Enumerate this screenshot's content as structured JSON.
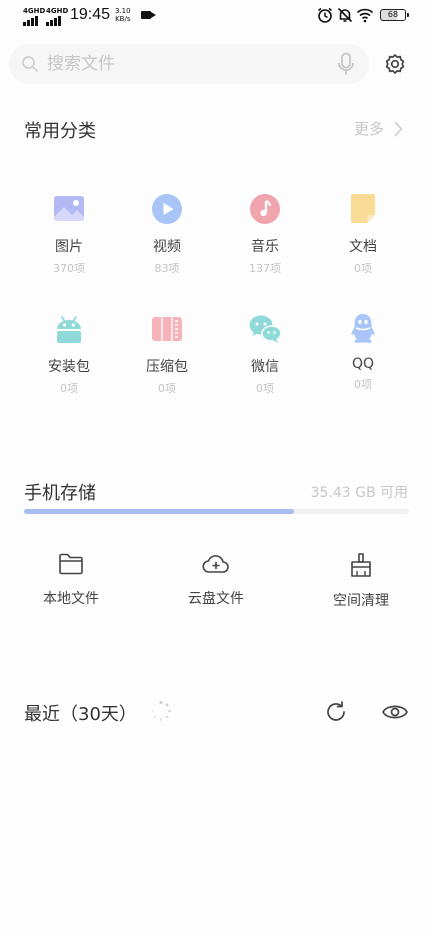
{
  "status_bar": {
    "signal1": "4GHD",
    "signal2": "4GHD",
    "time": "19:45",
    "speed_value": "3.10",
    "speed_unit": "KB/s",
    "battery": "68"
  },
  "search": {
    "placeholder": "搜索文件"
  },
  "categories_section": {
    "title": "常用分类",
    "more": "更多",
    "items": [
      {
        "label": "图片",
        "count": "370项",
        "icon": "image-icon",
        "color": "#b3b9f5"
      },
      {
        "label": "视频",
        "count": "83项",
        "icon": "video-icon",
        "color": "#a9c5f8"
      },
      {
        "label": "音乐",
        "count": "137项",
        "icon": "music-icon",
        "color": "#f0a4ae"
      },
      {
        "label": "文档",
        "count": "0项",
        "icon": "document-icon",
        "color": "#f8dc95"
      },
      {
        "label": "安装包",
        "count": "0项",
        "icon": "android-icon",
        "color": "#8fdad9"
      },
      {
        "label": "压缩包",
        "count": "0项",
        "icon": "zip-icon",
        "color": "#f5b3b9"
      },
      {
        "label": "微信",
        "count": "0项",
        "icon": "wechat-icon",
        "color": "#8fdad9"
      },
      {
        "label": "QQ",
        "count": "0项",
        "icon": "qq-icon",
        "color": "#a9c5f8"
      }
    ]
  },
  "storage": {
    "title": "手机存储",
    "available": "35.43 GB 可用",
    "used_fraction": 0.7,
    "bar_color": "#a7bdf2",
    "tools": [
      {
        "label": "本地文件",
        "icon": "folder-icon"
      },
      {
        "label": "云盘文件",
        "icon": "cloud-upload-icon"
      },
      {
        "label": "空间清理",
        "icon": "broom-icon"
      }
    ]
  },
  "recent": {
    "title": "最近（30天）"
  }
}
